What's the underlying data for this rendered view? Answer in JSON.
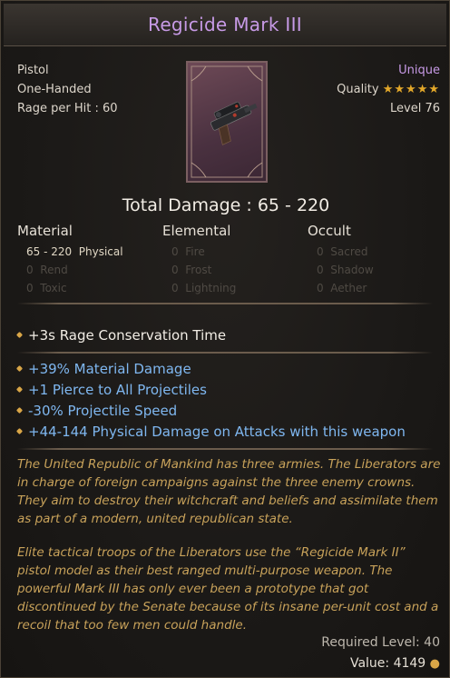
{
  "item": {
    "name": "Regicide Mark III",
    "type": "Pistol",
    "handed": "One-Handed",
    "rage_per_hit": "Rage per Hit : 60",
    "rarity": "Unique",
    "quality_label": "Quality",
    "quality_stars": 5,
    "level": "Level 76"
  },
  "damage": {
    "total": "Total Damage : 65 - 220",
    "columns": {
      "material": "Material",
      "elemental": "Elemental",
      "occult": "Occult"
    },
    "material": [
      {
        "value": "65 - 220",
        "type": "Physical",
        "active": true
      },
      {
        "value": "0",
        "type": "Rend",
        "active": false
      },
      {
        "value": "0",
        "type": "Toxic",
        "active": false
      }
    ],
    "elemental": [
      {
        "value": "0",
        "type": "Fire",
        "active": false
      },
      {
        "value": "0",
        "type": "Frost",
        "active": false
      },
      {
        "value": "0",
        "type": "Lightning",
        "active": false
      }
    ],
    "occult": [
      {
        "value": "0",
        "type": "Sacred",
        "active": false
      },
      {
        "value": "0",
        "type": "Shadow",
        "active": false
      },
      {
        "value": "0",
        "type": "Aether",
        "active": false
      }
    ]
  },
  "implicit": "+3s Rage Conservation Time",
  "modifiers": [
    "+39% Material Damage",
    "+1 Pierce to All Projectiles",
    "-30% Projectile Speed",
    "+44-144 Physical Damage on Attacks with this weapon"
  ],
  "lore": [
    "The United Republic of Mankind has three armies. The Liberators are",
    "in charge of foreign campaigns against the three enemy crowns.",
    "They aim to destroy their witchcraft and beliefs and assimilate them",
    "as part of a modern, united republican state.",
    "",
    "Elite tactical troops of the Liberators use the “Regicide Mark II”",
    "pistol model as their best ranged multi-purpose weapon. The",
    "powerful Mark III has only ever been a prototype that got",
    "discontinued by the Senate because of its insane per-unit cost and a",
    "recoil that too few men could handle."
  ],
  "required_level": "Required Level: 40",
  "value": "Value: 4149",
  "colors": {
    "unique": "#c79ae6",
    "modifier": "#7fb7f0",
    "lore": "#c8a25a",
    "star": "#e3a82a"
  },
  "icons": {
    "item_art": "pistol-card-icon",
    "quality": "star-icon",
    "currency": "coins-icon"
  }
}
